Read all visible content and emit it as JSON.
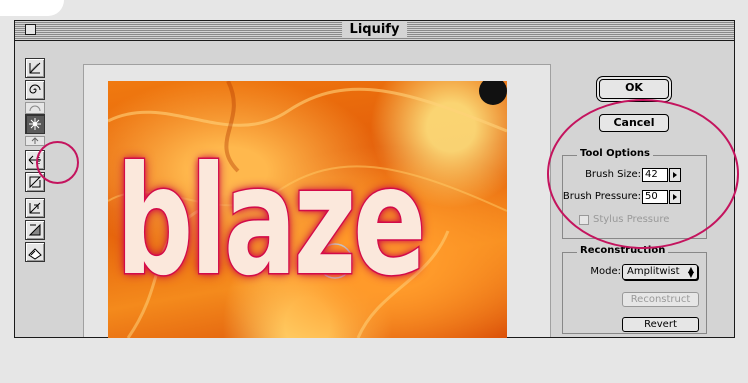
{
  "window": {
    "title": "Liquify"
  },
  "tools": [
    {
      "name": "warp-tool-icon"
    },
    {
      "name": "twirl-clockwise-tool-icon"
    },
    {
      "name": "twirl-counterclockwise-tool-icon"
    },
    {
      "name": "pucker-tool-icon",
      "active": true
    },
    {
      "name": "bloat-tool-icon"
    },
    {
      "name": "shift-pixels-tool-icon"
    },
    {
      "name": "reflection-tool-icon"
    },
    {
      "name": "reconstruct-tool-icon"
    },
    {
      "name": "freeze-tool-icon"
    },
    {
      "name": "thaw-tool-icon"
    }
  ],
  "preview": {
    "image_text": "blaze"
  },
  "buttons": {
    "ok": "OK",
    "cancel": "Cancel"
  },
  "tool_options": {
    "title": "Tool Options",
    "brush_size_label": "Brush Size:",
    "brush_size_value": "42",
    "brush_pressure_label": "Brush Pressure:",
    "brush_pressure_value": "50",
    "stylus_pressure_label": "Stylus Pressure",
    "stylus_pressure_checked": false
  },
  "reconstruction": {
    "title": "Reconstruction",
    "mode_label": "Mode:",
    "mode_value": "Amplitwist",
    "reconstruct_label": "Reconstruct",
    "revert_label": "Revert"
  },
  "colors": {
    "annotation": "#c4145e",
    "background": "#d4d4d4"
  }
}
